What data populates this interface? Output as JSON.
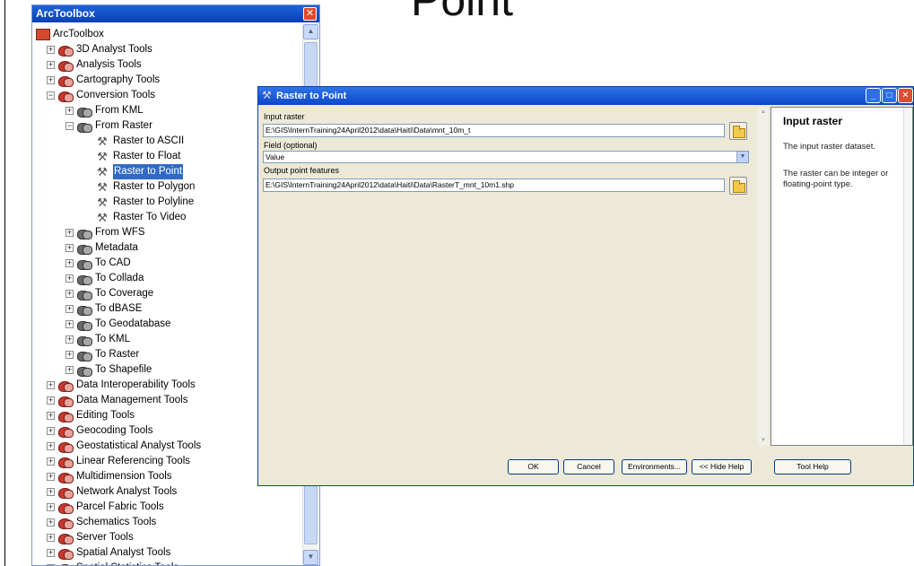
{
  "slide": {
    "title": "Point"
  },
  "toolbox": {
    "title": "ArcToolbox",
    "close_glyph": "✕",
    "rows": [
      {
        "label": "ArcToolbox",
        "level": 0,
        "kind": "root",
        "expander": ""
      },
      {
        "label": "3D Analyst Tools",
        "level": 1,
        "kind": "toolset",
        "expander": "+"
      },
      {
        "label": "Analysis Tools",
        "level": 1,
        "kind": "toolset",
        "expander": "+"
      },
      {
        "label": "Cartography Tools",
        "level": 1,
        "kind": "toolset",
        "expander": "+"
      },
      {
        "label": "Conversion Tools",
        "level": 1,
        "kind": "toolset",
        "expander": "−"
      },
      {
        "label": "From KML",
        "level": 2,
        "kind": "subset",
        "expander": "+"
      },
      {
        "label": "From Raster",
        "level": 2,
        "kind": "subset",
        "expander": "−"
      },
      {
        "label": "Raster to ASCII",
        "level": 3,
        "kind": "tool",
        "expander": ""
      },
      {
        "label": "Raster to Float",
        "level": 3,
        "kind": "tool",
        "expander": ""
      },
      {
        "label": "Raster to Point",
        "level": 3,
        "kind": "tool",
        "expander": "",
        "selected": true
      },
      {
        "label": "Raster to Polygon",
        "level": 3,
        "kind": "tool",
        "expander": ""
      },
      {
        "label": "Raster to Polyline",
        "level": 3,
        "kind": "tool",
        "expander": ""
      },
      {
        "label": "Raster To Video",
        "level": 3,
        "kind": "tool",
        "expander": ""
      },
      {
        "label": "From WFS",
        "level": 2,
        "kind": "subset",
        "expander": "+"
      },
      {
        "label": "Metadata",
        "level": 2,
        "kind": "subset",
        "expander": "+"
      },
      {
        "label": "To CAD",
        "level": 2,
        "kind": "subset",
        "expander": "+"
      },
      {
        "label": "To Collada",
        "level": 2,
        "kind": "subset",
        "expander": "+"
      },
      {
        "label": "To Coverage",
        "level": 2,
        "kind": "subset",
        "expander": "+"
      },
      {
        "label": "To dBASE",
        "level": 2,
        "kind": "subset",
        "expander": "+"
      },
      {
        "label": "To Geodatabase",
        "level": 2,
        "kind": "subset",
        "expander": "+"
      },
      {
        "label": "To KML",
        "level": 2,
        "kind": "subset",
        "expander": "+"
      },
      {
        "label": "To Raster",
        "level": 2,
        "kind": "subset",
        "expander": "+"
      },
      {
        "label": "To Shapefile",
        "level": 2,
        "kind": "subset",
        "expander": "+"
      },
      {
        "label": "Data Interoperability Tools",
        "level": 1,
        "kind": "toolset",
        "expander": "+"
      },
      {
        "label": "Data Management Tools",
        "level": 1,
        "kind": "toolset",
        "expander": "+"
      },
      {
        "label": "Editing Tools",
        "level": 1,
        "kind": "toolset",
        "expander": "+"
      },
      {
        "label": "Geocoding Tools",
        "level": 1,
        "kind": "toolset",
        "expander": "+"
      },
      {
        "label": "Geostatistical Analyst Tools",
        "level": 1,
        "kind": "toolset",
        "expander": "+"
      },
      {
        "label": "Linear Referencing Tools",
        "level": 1,
        "kind": "toolset",
        "expander": "+"
      },
      {
        "label": "Multidimension Tools",
        "level": 1,
        "kind": "toolset",
        "expander": "+"
      },
      {
        "label": "Network Analyst Tools",
        "level": 1,
        "kind": "toolset",
        "expander": "+"
      },
      {
        "label": "Parcel Fabric Tools",
        "level": 1,
        "kind": "toolset",
        "expander": "+"
      },
      {
        "label": "Schematics Tools",
        "level": 1,
        "kind": "toolset",
        "expander": "+"
      },
      {
        "label": "Server Tools",
        "level": 1,
        "kind": "toolset",
        "expander": "+"
      },
      {
        "label": "Spatial Analyst Tools",
        "level": 1,
        "kind": "toolset",
        "expander": "+"
      },
      {
        "label": "Spatial Statistics Tools",
        "level": 1,
        "kind": "toolset",
        "expander": "+"
      }
    ]
  },
  "dialog": {
    "title": "Raster to Point",
    "window_buttons": {
      "minimize": "_",
      "maximize": "□",
      "close": "✕"
    },
    "params": {
      "input_raster_label": "Input raster",
      "input_raster_value": "E:\\GIS\\InternTraining24April2012\\data\\Haiti\\Data\\mnt_10m_t",
      "field_label": "Field (optional)",
      "field_value": "Value",
      "output_label": "Output point features",
      "output_value": "E:\\GIS\\InternTraining24April2012\\data\\Haiti\\Data\\RasterT_mnt_10m1.shp"
    },
    "help": {
      "title": "Input raster",
      "line1": "The input raster dataset.",
      "line2": "The raster can be integer or floating-point type."
    },
    "buttons": {
      "ok": "OK",
      "cancel": "Cancel",
      "environments": "Environments...",
      "hide_help": "<< Hide Help",
      "tool_help": "Tool Help"
    }
  },
  "colors": {
    "selection": "#316ac5",
    "titlebar": "#0b48c8",
    "dialog_bg": "#ece9d8"
  }
}
